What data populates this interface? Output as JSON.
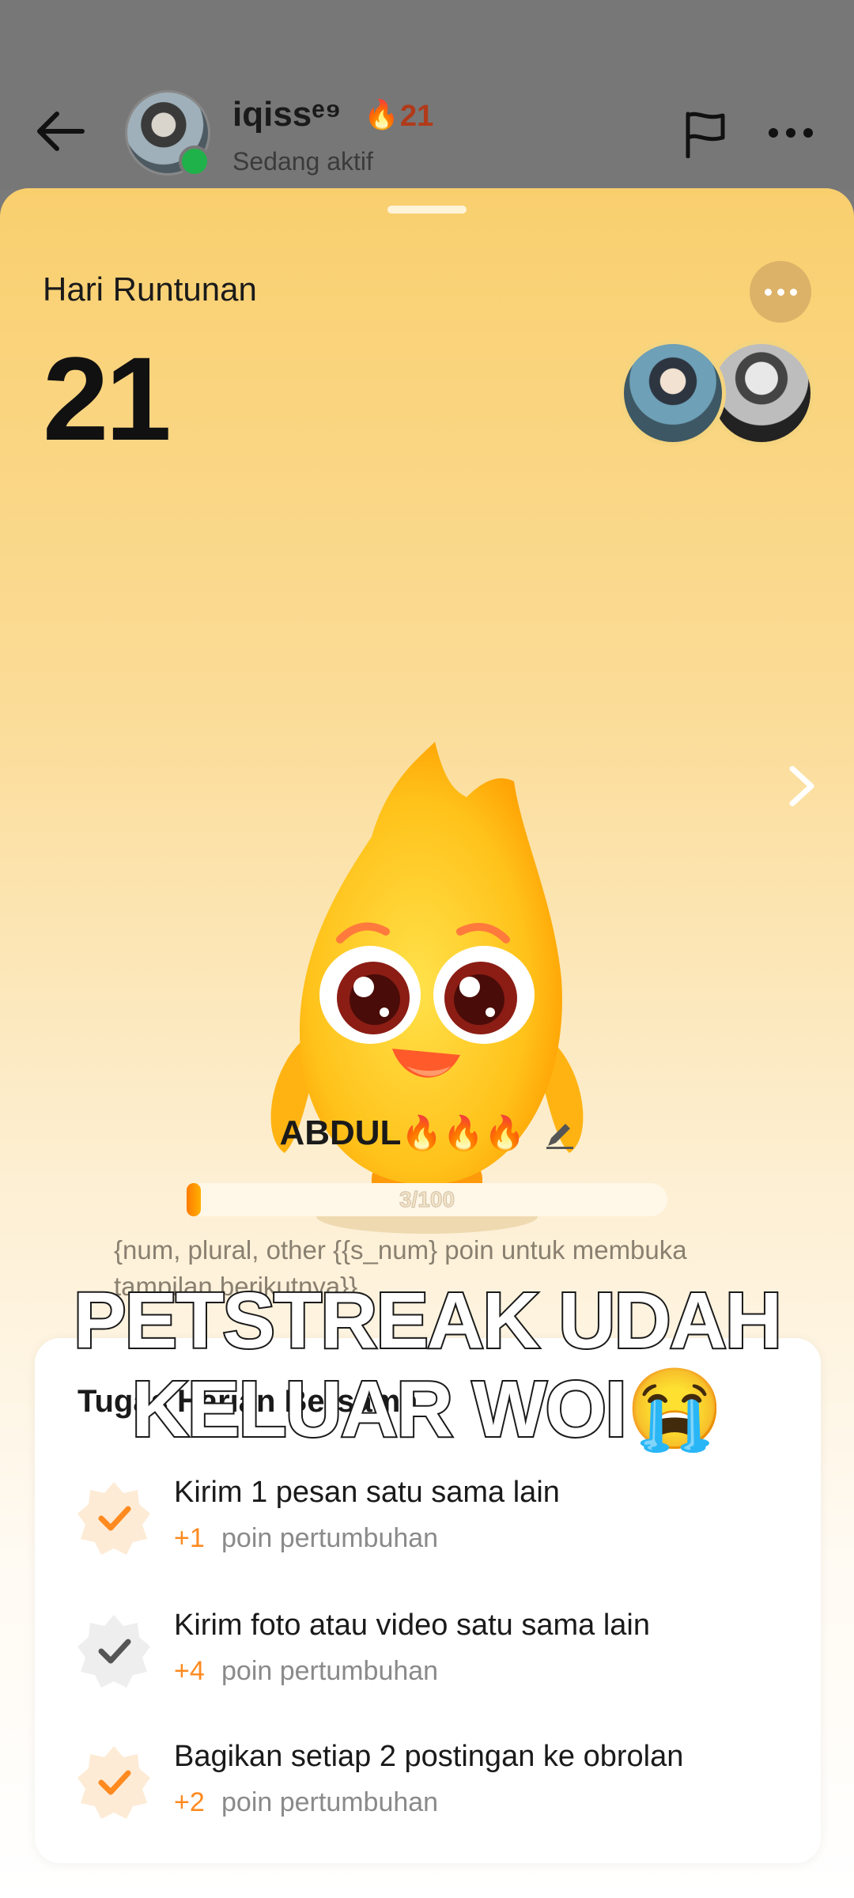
{
  "header": {
    "back_icon": "arrow-left-icon",
    "username": "iqissᵉ⁹",
    "fire_emoji": "🔥",
    "streak_count": "21",
    "status": "Sedang aktif",
    "flag_icon": "flag-icon",
    "more_icon": "more-horizontal-icon"
  },
  "sheet": {
    "title": "Hari Runtunan",
    "streak_days": "21",
    "pet_name": "ABDUL",
    "pet_fires": "🔥🔥🔥",
    "progress": {
      "label": "3/100",
      "fraction": 0.03
    },
    "points_note": "{num, plural, other {{s_num} poin untuk membuka tampilan berikutnya}}"
  },
  "tasks_card": {
    "title": "Tugas Harian Bersama",
    "points_label": "poin pertumbuhan",
    "items": [
      {
        "title": "Kirim 1 pesan satu sama lain",
        "points": "+1",
        "done": true
      },
      {
        "title": "Kirim foto atau video satu sama lain",
        "points": "+4",
        "done": false
      },
      {
        "title": "Bagikan setiap 2 postingan ke obrolan",
        "points": "+2",
        "done": true
      }
    ]
  },
  "caption": {
    "line1": "PETSTREAK UDAH",
    "line2": "KELUAR WOI",
    "emoji": "😭"
  },
  "colors": {
    "sheet_top": "#f9cf6e",
    "progress_accent": "#ff8a1f",
    "online": "#1fb24a",
    "check_done": "#ff8a1f",
    "check_pending": "#555555"
  }
}
